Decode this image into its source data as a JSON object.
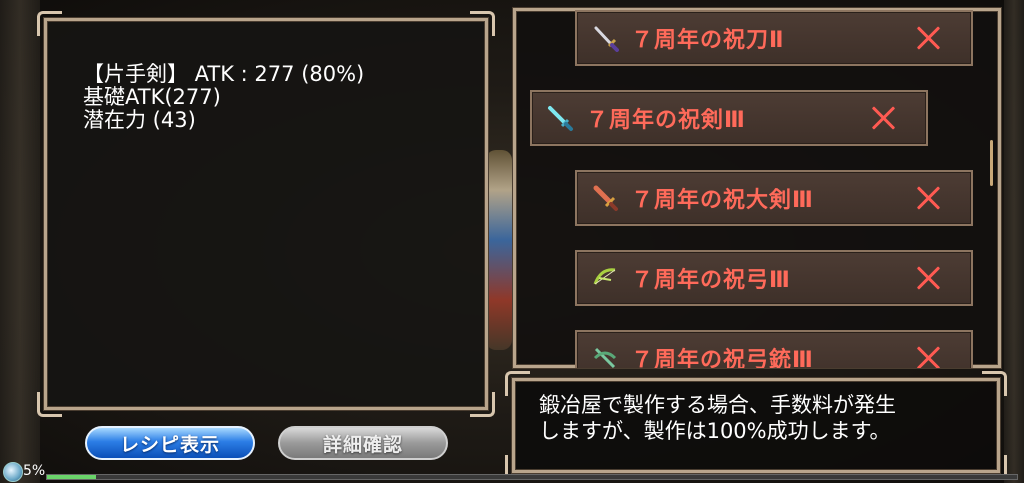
{
  "stats": {
    "line1": "【片手剣】 ATK : 277 (80%)",
    "line2": "基礎ATK(277)",
    "line3": "潜在力 (43)"
  },
  "recipes": [
    {
      "name": "７周年の祝刀Ⅱ",
      "icon": "katana-icon",
      "color": "#ff6a5a"
    },
    {
      "name": "７周年の祝剣Ⅲ",
      "icon": "sword-icon",
      "color": "#ff6a5a"
    },
    {
      "name": "７周年の祝大剣Ⅲ",
      "icon": "greatsword-icon",
      "color": "#ff6a5a"
    },
    {
      "name": "７周年の祝弓Ⅲ",
      "icon": "bow-icon",
      "color": "#ff6a5a"
    },
    {
      "name": "７周年の祝弓銃Ⅲ",
      "icon": "crossbow-icon",
      "color": "#ff6a5a"
    }
  ],
  "info": {
    "line1": "鍛冶屋で製作する場合、手数料が発生",
    "line2": "しますが、製作は100%成功します。"
  },
  "buttons": {
    "recipe_label": "レシピ表示",
    "detail_label": "詳細確認"
  },
  "status": {
    "percent_text": "5%",
    "progress": 0.05
  },
  "colors": {
    "recipe_text": "#ff6a5a",
    "close_x": "#ff5a52",
    "frame": "#b9a58c",
    "button_blue": "#2c7ee6"
  }
}
